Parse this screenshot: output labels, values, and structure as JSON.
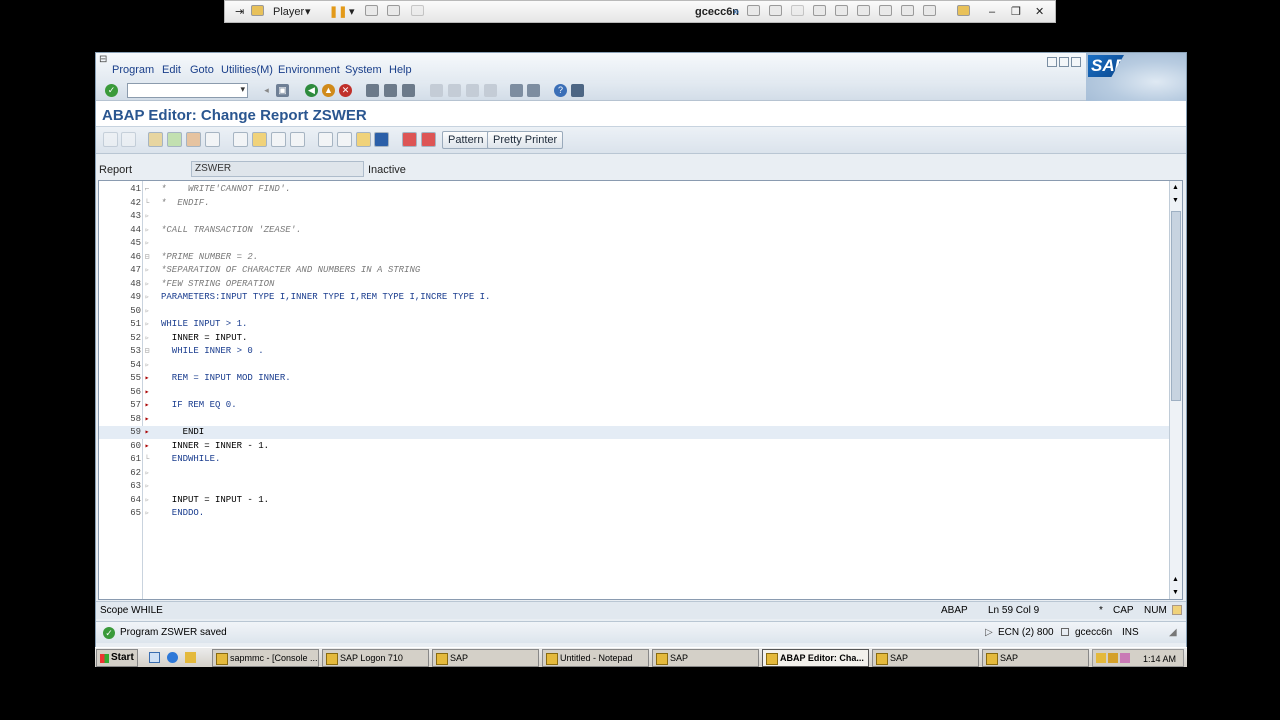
{
  "player": {
    "menu_label": "Player",
    "vm_name": "gcecc6n"
  },
  "menu": [
    "Program",
    "Edit",
    "Goto",
    "Utilities(M)",
    "Environment",
    "System",
    "Help"
  ],
  "sap_logo_text": "SAP",
  "title": "ABAP Editor: Change Report ZSWER",
  "app_toolbar": {
    "pattern": "Pattern",
    "pretty_printer": "Pretty Printer"
  },
  "header": {
    "report_label": "Report",
    "program_name": "ZSWER",
    "status": "Inactive"
  },
  "code_lines": [
    {
      "n": "41",
      "text": "*    WRITE'CANNOT FIND'."
    },
    {
      "n": "42",
      "text": "*  ENDIF."
    },
    {
      "n": "43",
      "text": ""
    },
    {
      "n": "44",
      "text": "*CALL TRANSACTION 'ZEASE'."
    },
    {
      "n": "45",
      "text": ""
    },
    {
      "n": "46",
      "text": "*PRIME NUMBER = 2."
    },
    {
      "n": "47",
      "text": "*SEPARATION OF CHARACTER AND NUMBERS IN A STRING"
    },
    {
      "n": "48",
      "text": "*FEW STRING OPERATION"
    },
    {
      "n": "49",
      "text": "PARAMETERS:INPUT TYPE I,INNER TYPE I,REM TYPE I,INCRE TYPE I."
    },
    {
      "n": "50",
      "text": ""
    },
    {
      "n": "51",
      "text": "WHILE INPUT > 1."
    },
    {
      "n": "52",
      "text": "  INNER = INPUT."
    },
    {
      "n": "53",
      "text": "  WHILE INNER > 0 ."
    },
    {
      "n": "54",
      "text": ""
    },
    {
      "n": "55",
      "text": "  REM = INPUT MOD INNER."
    },
    {
      "n": "56",
      "text": ""
    },
    {
      "n": "57",
      "text": "  IF REM EQ 0."
    },
    {
      "n": "58",
      "text": ""
    },
    {
      "n": "59",
      "text": "    ENDI"
    },
    {
      "n": "60",
      "text": "  INNER = INNER - 1."
    },
    {
      "n": "61",
      "text": "  ENDWHILE."
    },
    {
      "n": "62",
      "text": ""
    },
    {
      "n": "63",
      "text": ""
    },
    {
      "n": "64",
      "text": "  INPUT = INPUT - 1."
    },
    {
      "n": "65",
      "text": "  ENDDO."
    }
  ],
  "scope_bar": {
    "scope": "Scope WHILE",
    "lang": "ABAP",
    "position": "Ln 59 Col  9",
    "star": "*",
    "cap": "CAP",
    "num": "NUM"
  },
  "status_bar": {
    "message": "Program ZSWER saved",
    "system": "ECN (2) 800",
    "server": "gcecc6n",
    "mode": "INS"
  },
  "taskbar": {
    "start": "Start",
    "items": [
      "sapmmc - [Console ...",
      "SAP Logon 710",
      "SAP",
      "Untitled - Notepad",
      "SAP",
      "ABAP Editor: Cha...",
      "SAP",
      "SAP"
    ],
    "clock": "1:14 AM"
  },
  "colors": {
    "sap_blue": "#2a5690",
    "comment": "#7a7a7a",
    "keyword": "#1a3d8f",
    "number": "#4a75c8"
  }
}
